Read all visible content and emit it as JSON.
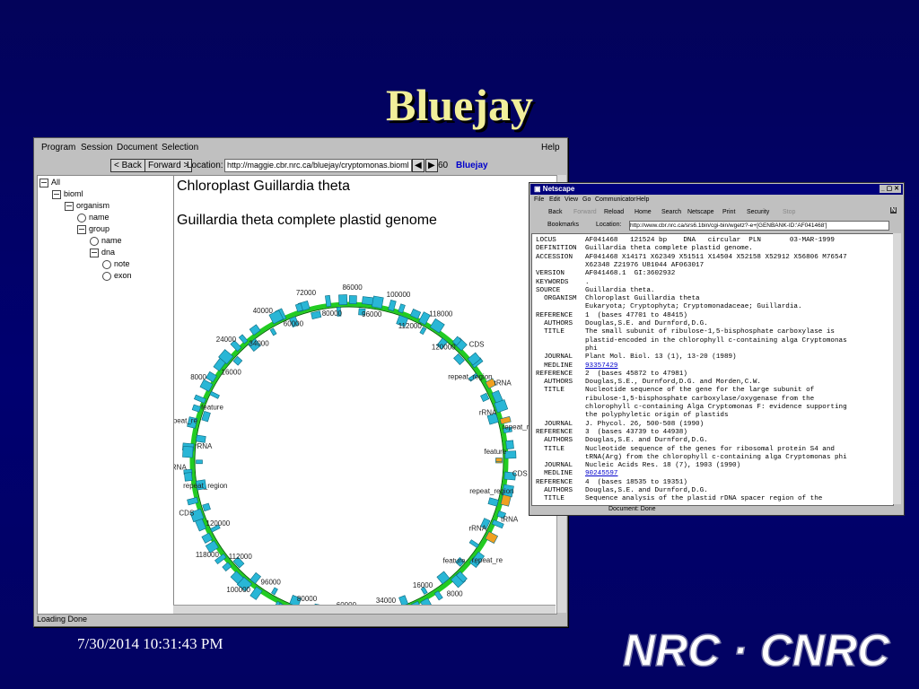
{
  "slide": {
    "title": "Bluejay",
    "date": "7/30/2014 10:31:43 PM",
    "logo": "NRC · CNRC"
  },
  "bluejay": {
    "menu": [
      "Program",
      "Session",
      "Document",
      "Selection"
    ],
    "help": "Help",
    "back": "< Back",
    "forward": "Forward >",
    "location_label": "Location:",
    "url": "http://maggie.cbr.nrc.ca/bluejay/cryptomonas.bioml",
    "zoom": "60",
    "brand": "Bluejay",
    "tree": [
      {
        "label": "All",
        "icon": "box",
        "level": 0
      },
      {
        "label": "bioml",
        "icon": "box",
        "level": 1
      },
      {
        "label": "organism",
        "icon": "box",
        "level": 2
      },
      {
        "label": "name",
        "icon": "circle",
        "level": 3
      },
      {
        "label": "group",
        "icon": "box",
        "level": 3
      },
      {
        "label": "name",
        "icon": "circle",
        "level": 4
      },
      {
        "label": "dna",
        "icon": "box",
        "level": 4
      },
      {
        "label": "note",
        "icon": "circle",
        "level": 5
      },
      {
        "label": "exon",
        "icon": "circle",
        "level": 5
      }
    ],
    "heading": "Chloroplast Guillardia theta",
    "subheading": "Guillardia theta complete plastid genome",
    "status": "Loading Done",
    "map_labels": [
      "CDS",
      "repeat_region",
      "tRNA",
      "rRNA",
      "repeat_re",
      "feature",
      "8000",
      "16000",
      "24000",
      "34000",
      "40000",
      "60000",
      "72000",
      "80000",
      "86000",
      "96000",
      "100000",
      "112000",
      "118000",
      "120000"
    ]
  },
  "netscape": {
    "title": "Netscape",
    "menu": [
      "File",
      "Edit",
      "View",
      "Go",
      "Communicator",
      "Help"
    ],
    "toolbar": [
      "Back",
      "Forward",
      "Reload",
      "Home",
      "Search",
      "Netscape",
      "Print",
      "Security",
      "Stop"
    ],
    "bookmarks": "Bookmarks",
    "location_label": "Location:",
    "url": "http://www.cbr.nrc.ca/srs6.1bin/cgi-bin/wgetz?-e+[GENBANK-ID:'AF041468']",
    "status": "Document: Done",
    "record": [
      {
        "k": "LOCUS",
        "v": "AF041468   121524 bp    DNA   circular  PLN       03-MAR-1999"
      },
      {
        "k": "DEFINITION",
        "v": "Guillardia theta complete plastid genome."
      },
      {
        "k": "ACCESSION",
        "v": "AF041468 X14171 X62349 X51511 X14504 X52158 X52912 X56806 M76547"
      },
      {
        "k": "",
        "v": "X62348 Z21976 U81044 AF063017"
      },
      {
        "k": "VERSION",
        "v": "AF041468.1  GI:3602932"
      },
      {
        "k": "KEYWORDS",
        "v": "."
      },
      {
        "k": "SOURCE",
        "v": "Guillardia theta."
      },
      {
        "k": "  ORGANISM",
        "v": "Chloroplast Guillardia theta"
      },
      {
        "k": "",
        "v": "Eukaryota; Cryptophyta; Cryptomonadaceae; Guillardia."
      },
      {
        "k": "REFERENCE",
        "v": "1  (bases 47701 to 48415)"
      },
      {
        "k": "  AUTHORS",
        "v": "Douglas,S.E. and Durnford,D.G."
      },
      {
        "k": "  TITLE",
        "v": "The small subunit of ribulose-1,5-bisphosphate carboxylase is"
      },
      {
        "k": "",
        "v": "plastid-encoded in the chlorophyll c-containing alga Cryptomonas"
      },
      {
        "k": "",
        "v": "phi"
      },
      {
        "k": "  JOURNAL",
        "v": "Plant Mol. Biol. 13 (1), 13-20 (1989)"
      },
      {
        "k": "  MEDLINE",
        "v": "93357429",
        "link": true
      },
      {
        "k": "REFERENCE",
        "v": "2  (bases 45872 to 47981)"
      },
      {
        "k": "  AUTHORS",
        "v": "Douglas,S.E., Durnford,D.G. and Morden,C.W."
      },
      {
        "k": "  TITLE",
        "v": "Nucleotide sequence of the gene for the large subunit of"
      },
      {
        "k": "",
        "v": "ribulose-1,5-bisphosphate carboxylase/oxygenase from the"
      },
      {
        "k": "",
        "v": "chlorophyll c-containing Alga Cryptomonas F: evidence supporting"
      },
      {
        "k": "",
        "v": "the polyphyletic origin of plastids"
      },
      {
        "k": "  JOURNAL",
        "v": "J. Phycol. 26, 500-508 (1990)"
      },
      {
        "k": "REFERENCE",
        "v": "3  (bases 43739 to 44938)"
      },
      {
        "k": "  AUTHORS",
        "v": "Douglas,S.E. and Durnford,D.G."
      },
      {
        "k": "  TITLE",
        "v": "Nucleotide sequence of the genes for ribosomal protein S4 and"
      },
      {
        "k": "",
        "v": "tRNA(Arg) from the chlorophyll c-containing alga Cryptomonas phi"
      },
      {
        "k": "  JOURNAL",
        "v": "Nucleic Acids Res. 18 (7), 1903 (1990)"
      },
      {
        "k": "  MEDLINE",
        "v": "90245597",
        "link": true
      },
      {
        "k": "REFERENCE",
        "v": "4  (bases 18535 to 19351)"
      },
      {
        "k": "  AUTHORS",
        "v": "Douglas,S.E. and Durnford,D.G."
      },
      {
        "k": "  TITLE",
        "v": "Sequence analysis of the plastid rDNA spacer region of the"
      }
    ]
  },
  "colors": {
    "ring": "#22cc22",
    "feature": "#29b6d6",
    "highlight": "#f0a020",
    "title": "#f2ef9a"
  }
}
